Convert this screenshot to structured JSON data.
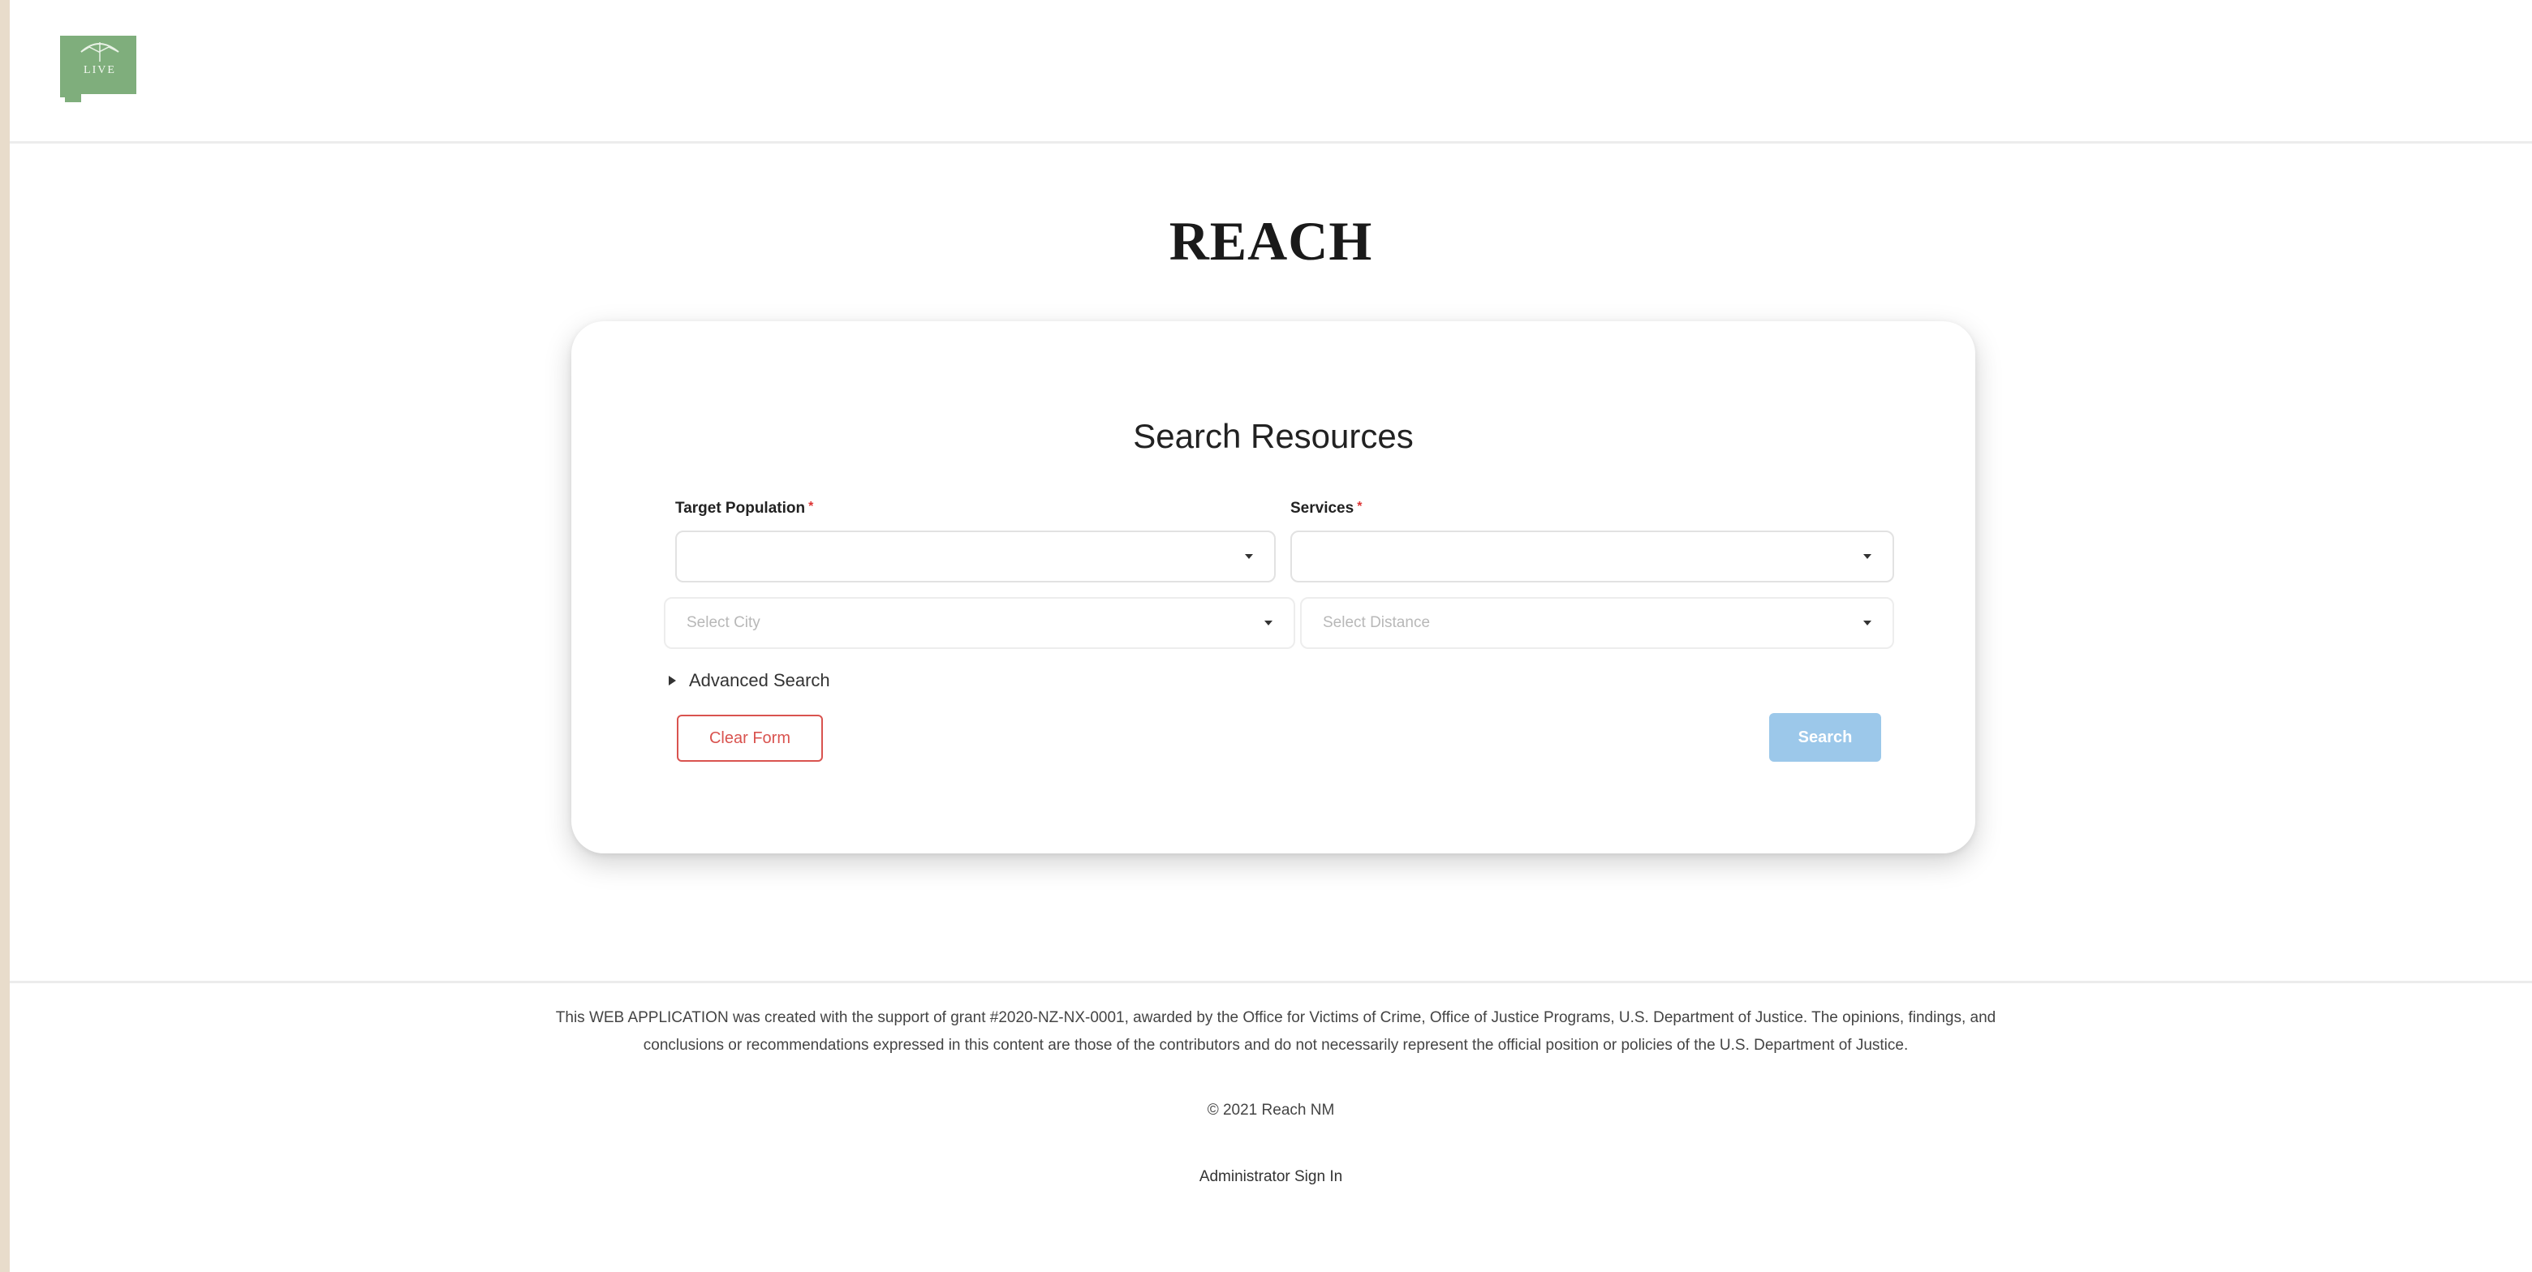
{
  "header": {
    "logo_icon": "new-mexico-state-umbrella-logo",
    "logo_text": "LIVE"
  },
  "brand": {
    "title": "REACH"
  },
  "search_card": {
    "title": "Search Resources",
    "target_population": {
      "label": "Target Population",
      "required_marker": "*",
      "value": ""
    },
    "services": {
      "label": "Services",
      "required_marker": "*",
      "value": ""
    },
    "city": {
      "placeholder": "Select City"
    },
    "distance": {
      "placeholder": "Select Distance"
    },
    "advanced_search_label": "Advanced Search",
    "clear_button_label": "Clear Form",
    "search_button_label": "Search"
  },
  "footer": {
    "disclaimer": "This WEB APPLICATION was created with the support of grant #2020-NZ-NX-0001, awarded by the Office for Victims of Crime, Office of Justice Programs, U.S. Department of Justice. The opinions, findings, and conclusions or recommendations expressed in this content are those of the contributors and do not necessarily represent the official position or policies of the U.S. Department of Justice.",
    "copyright": "© 2021 Reach NM",
    "admin_link": "Administrator Sign In"
  },
  "colors": {
    "page_border": "#e8dccb",
    "logo_green": "#7fae7c",
    "required_red": "#dd3333",
    "clear_button_red": "#d9534f",
    "search_button_blue": "#9cc8ea"
  }
}
